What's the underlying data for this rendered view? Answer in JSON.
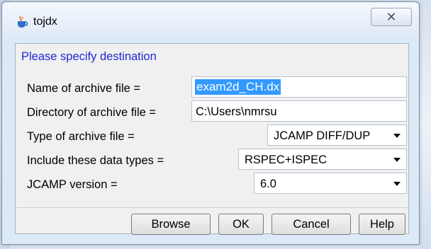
{
  "window": {
    "title": "tojdx",
    "close_glyph": "✕",
    "icon": "java-coffee-icon"
  },
  "form": {
    "heading": "Please specify destination",
    "name_label": "Name of archive file =",
    "name_value": "exam2d_CH.dx",
    "dir_label": "Directory of archive file =",
    "dir_value": "C:\\Users\\nmrsu",
    "type_label": "Type of archive file =",
    "type_value": "JCAMP DIFF/DUP",
    "datatypes_label": "Include these data types =",
    "datatypes_value": "RSPEC+ISPEC",
    "version_label": "JCAMP version =",
    "version_value": "6.0"
  },
  "buttons": {
    "browse": "Browse",
    "ok": "OK",
    "cancel": "Cancel",
    "help": "Help"
  },
  "colors": {
    "heading": "#1e28d8",
    "selection": "#3399ff"
  }
}
